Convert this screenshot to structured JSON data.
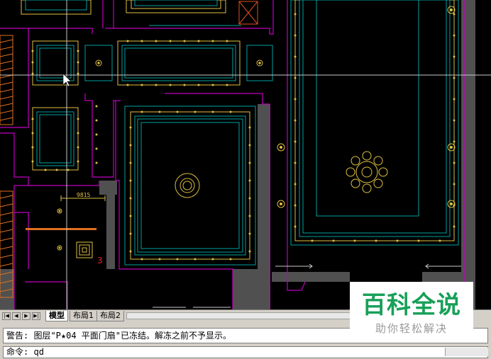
{
  "layout_tabs": {
    "model": "模型",
    "layout1": "布局1",
    "layout2": "布局2"
  },
  "nav_buttons": {
    "first": "|◀",
    "prev": "◀",
    "next": "▶",
    "last": "▶|"
  },
  "cad_text": {
    "dimension_value": "9815"
  },
  "command": {
    "history_line": "警告: 图层\"P★04 平面门扇\"已冻结。解冻之前不予显示。",
    "prompt_label": "命令:",
    "current_input": "qd"
  },
  "watermark": {
    "title": "百科全说",
    "subtitle": "助你轻松解决"
  },
  "colors": {
    "background": "#000000",
    "wall_magenta": "#c000c0",
    "cyan_lines": "#00a0a0",
    "yellow_fixture": "#e0c040",
    "orange": "#e07020",
    "gray_fill": "#505050",
    "brand_green": "#18a058"
  }
}
